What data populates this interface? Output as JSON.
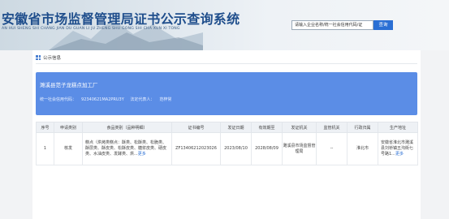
{
  "header": {
    "title": "安徽省市场监督管理局证书公示查询系统",
    "subtitle": "AN HUI SHENG SHI CHANG JIAN DU GUAN LI JU ZHENG SHU GONG SHI CHA XUN XI TONG",
    "search_placeholder": "请输入企业名称/统一社会信用代码/证",
    "search_button": "查询"
  },
  "section": {
    "title": "公示信息"
  },
  "company": {
    "name": "濉溪县范子龙糕点加工厂",
    "credit_code_label": "统一社会信用代码：",
    "credit_code": "92340621MA2PRU3Y",
    "legal_rep_label": "法定代表人：",
    "legal_rep": "范梓常"
  },
  "table": {
    "headers": [
      "序号",
      "申请类别",
      "食品类别（品种明细）",
      "证书编号",
      "发证日期",
      "有效期至",
      "发证机关",
      "监管机关",
      "行政归属",
      "生产地址"
    ],
    "rows": [
      {
        "index": "1",
        "type": "核发",
        "category": "糕点（烘烤类糕点：酥类、松酥类、松脆类、酥层类、酥皮类、松酥皮类、糖浆皮类、硬皮类、水油皮类、发酵类、烘...",
        "category_more": "更多",
        "cert_no": "ZF13406212023026",
        "issue_date": "2023/08/10",
        "expire_date": "2028/08/09",
        "issuer": "濉溪县市场监督管理局",
        "supervisor": "--",
        "region": "淮北市",
        "address": "安徽省淮北市濉溪县刘桥镇五沟街七号路1...",
        "address_more": "更多"
      }
    ]
  }
}
